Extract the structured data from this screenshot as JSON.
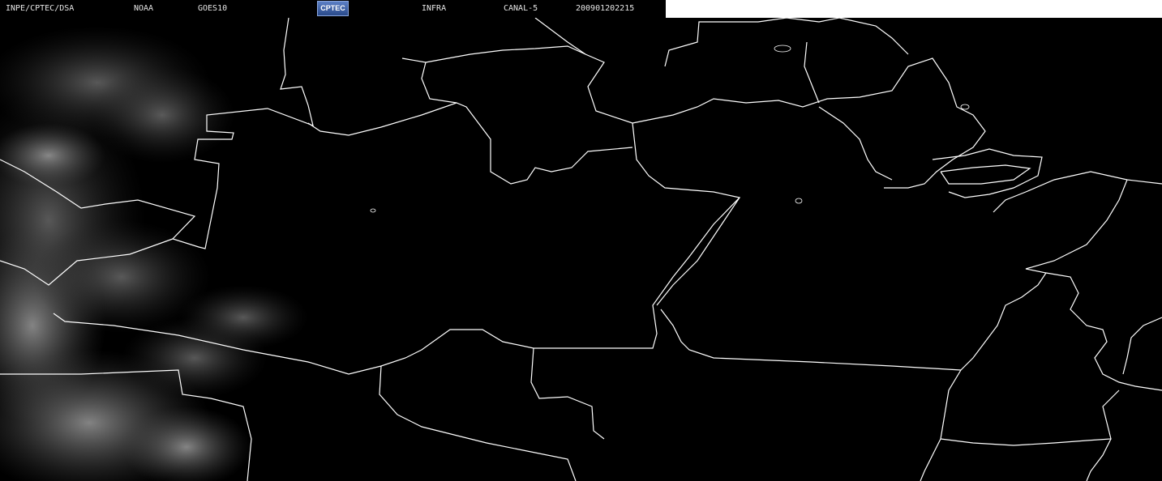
{
  "header": {
    "agency": "INPE/CPTEC/DSA",
    "source": "NOAA",
    "satellite": "GOES10",
    "logo_text": "CPTEC",
    "product": "INFRA",
    "channel": "CANAL-5",
    "timestamp": "200901202215"
  },
  "colors": {
    "background": "#000000",
    "borders": "#ffffff",
    "clouds": "#8a8a8a"
  }
}
